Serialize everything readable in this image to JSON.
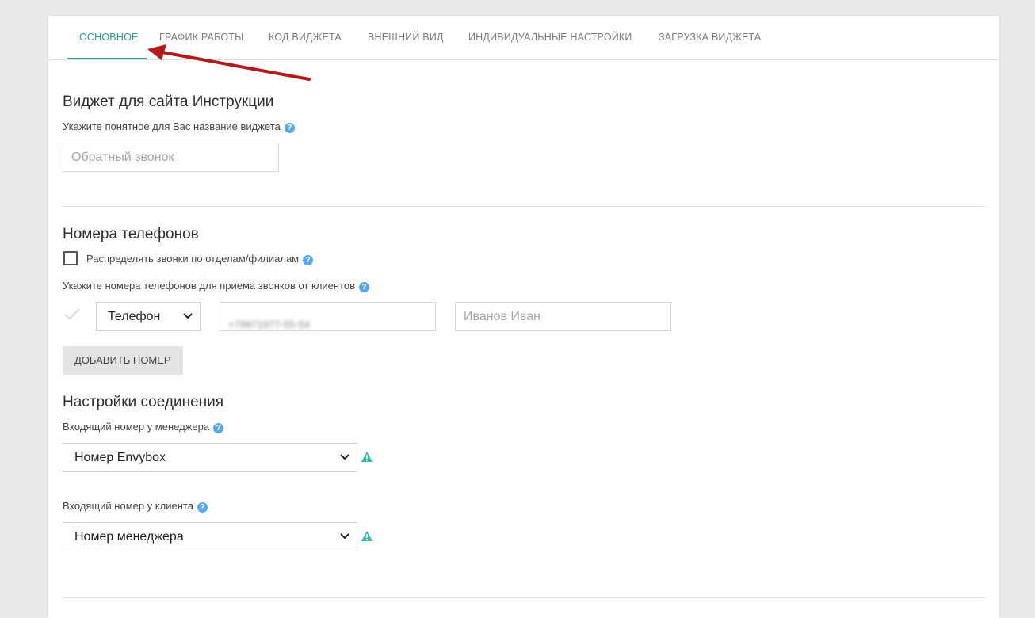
{
  "tabs": [
    {
      "label": "Основное",
      "active": true
    },
    {
      "label": "График работы"
    },
    {
      "label": "Код виджета"
    },
    {
      "label": "Внешний вид"
    },
    {
      "label": "Индивидуальные настройки"
    },
    {
      "label": "Загрузка виджета"
    }
  ],
  "colors": {
    "accent": "#2a9d95",
    "help": "#5aa9e6",
    "annotation_arrow": "#b31b1b"
  },
  "widget": {
    "title": "Виджет для сайта Инструкции",
    "name_label": "Укажите понятное для Вас название виджета",
    "name_placeholder": "Обратный звонок"
  },
  "phones": {
    "title": "Номера телефонов",
    "distribute_label": "Распределять звонки по отделам/филиалам",
    "distribute_checked": false,
    "numbers_label": "Укажите номера телефонов для приема звонков от клиентов",
    "type_select": "Телефон",
    "number_value": "+79971977-55-54",
    "owner_placeholder": "Иванов Иван",
    "add_button": "Добавить номер"
  },
  "connection": {
    "title": "Настройки соединения",
    "manager_label": "Входящий номер у менеджера",
    "manager_value": "Номер Envybox",
    "client_label": "Входящий номер у клиента",
    "client_value": "Номер менеджера"
  },
  "icons": {
    "help": "?",
    "chevron": "chevron-down-icon",
    "warning": "warning-icon",
    "check": "check-icon"
  }
}
